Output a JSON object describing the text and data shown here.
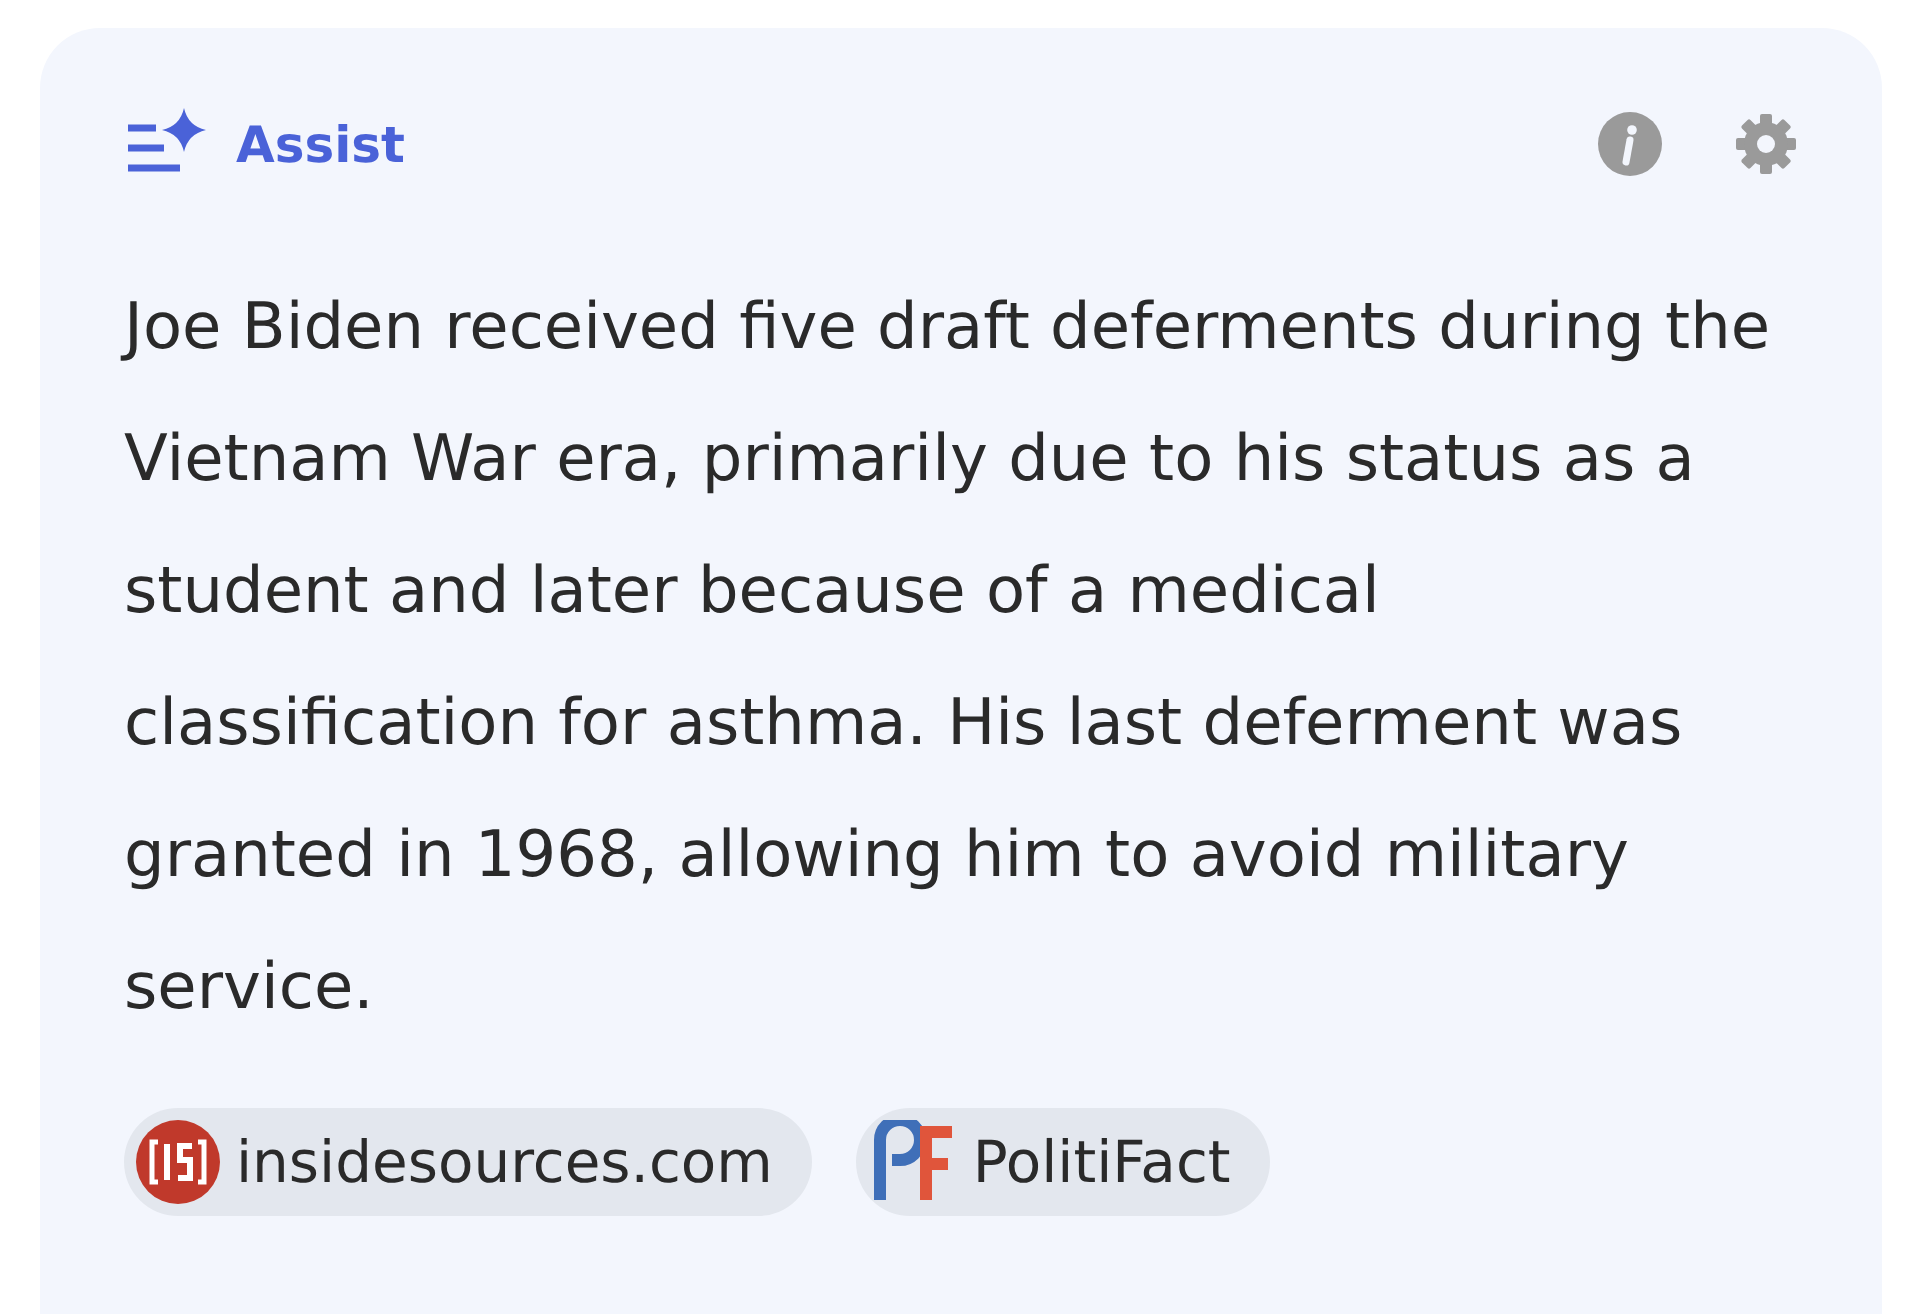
{
  "header": {
    "title": "Assist"
  },
  "answer": "Joe Biden received five draft deferments during the Vietnam War era, primarily due to his status as a student and later because of a medical classification for asthma. His last deferment was granted in 1968, allowing him to avoid military service.",
  "sources": [
    {
      "kind": "insidesources",
      "label": "insidesources.com"
    },
    {
      "kind": "politifact",
      "label": "PolitiFact"
    }
  ]
}
